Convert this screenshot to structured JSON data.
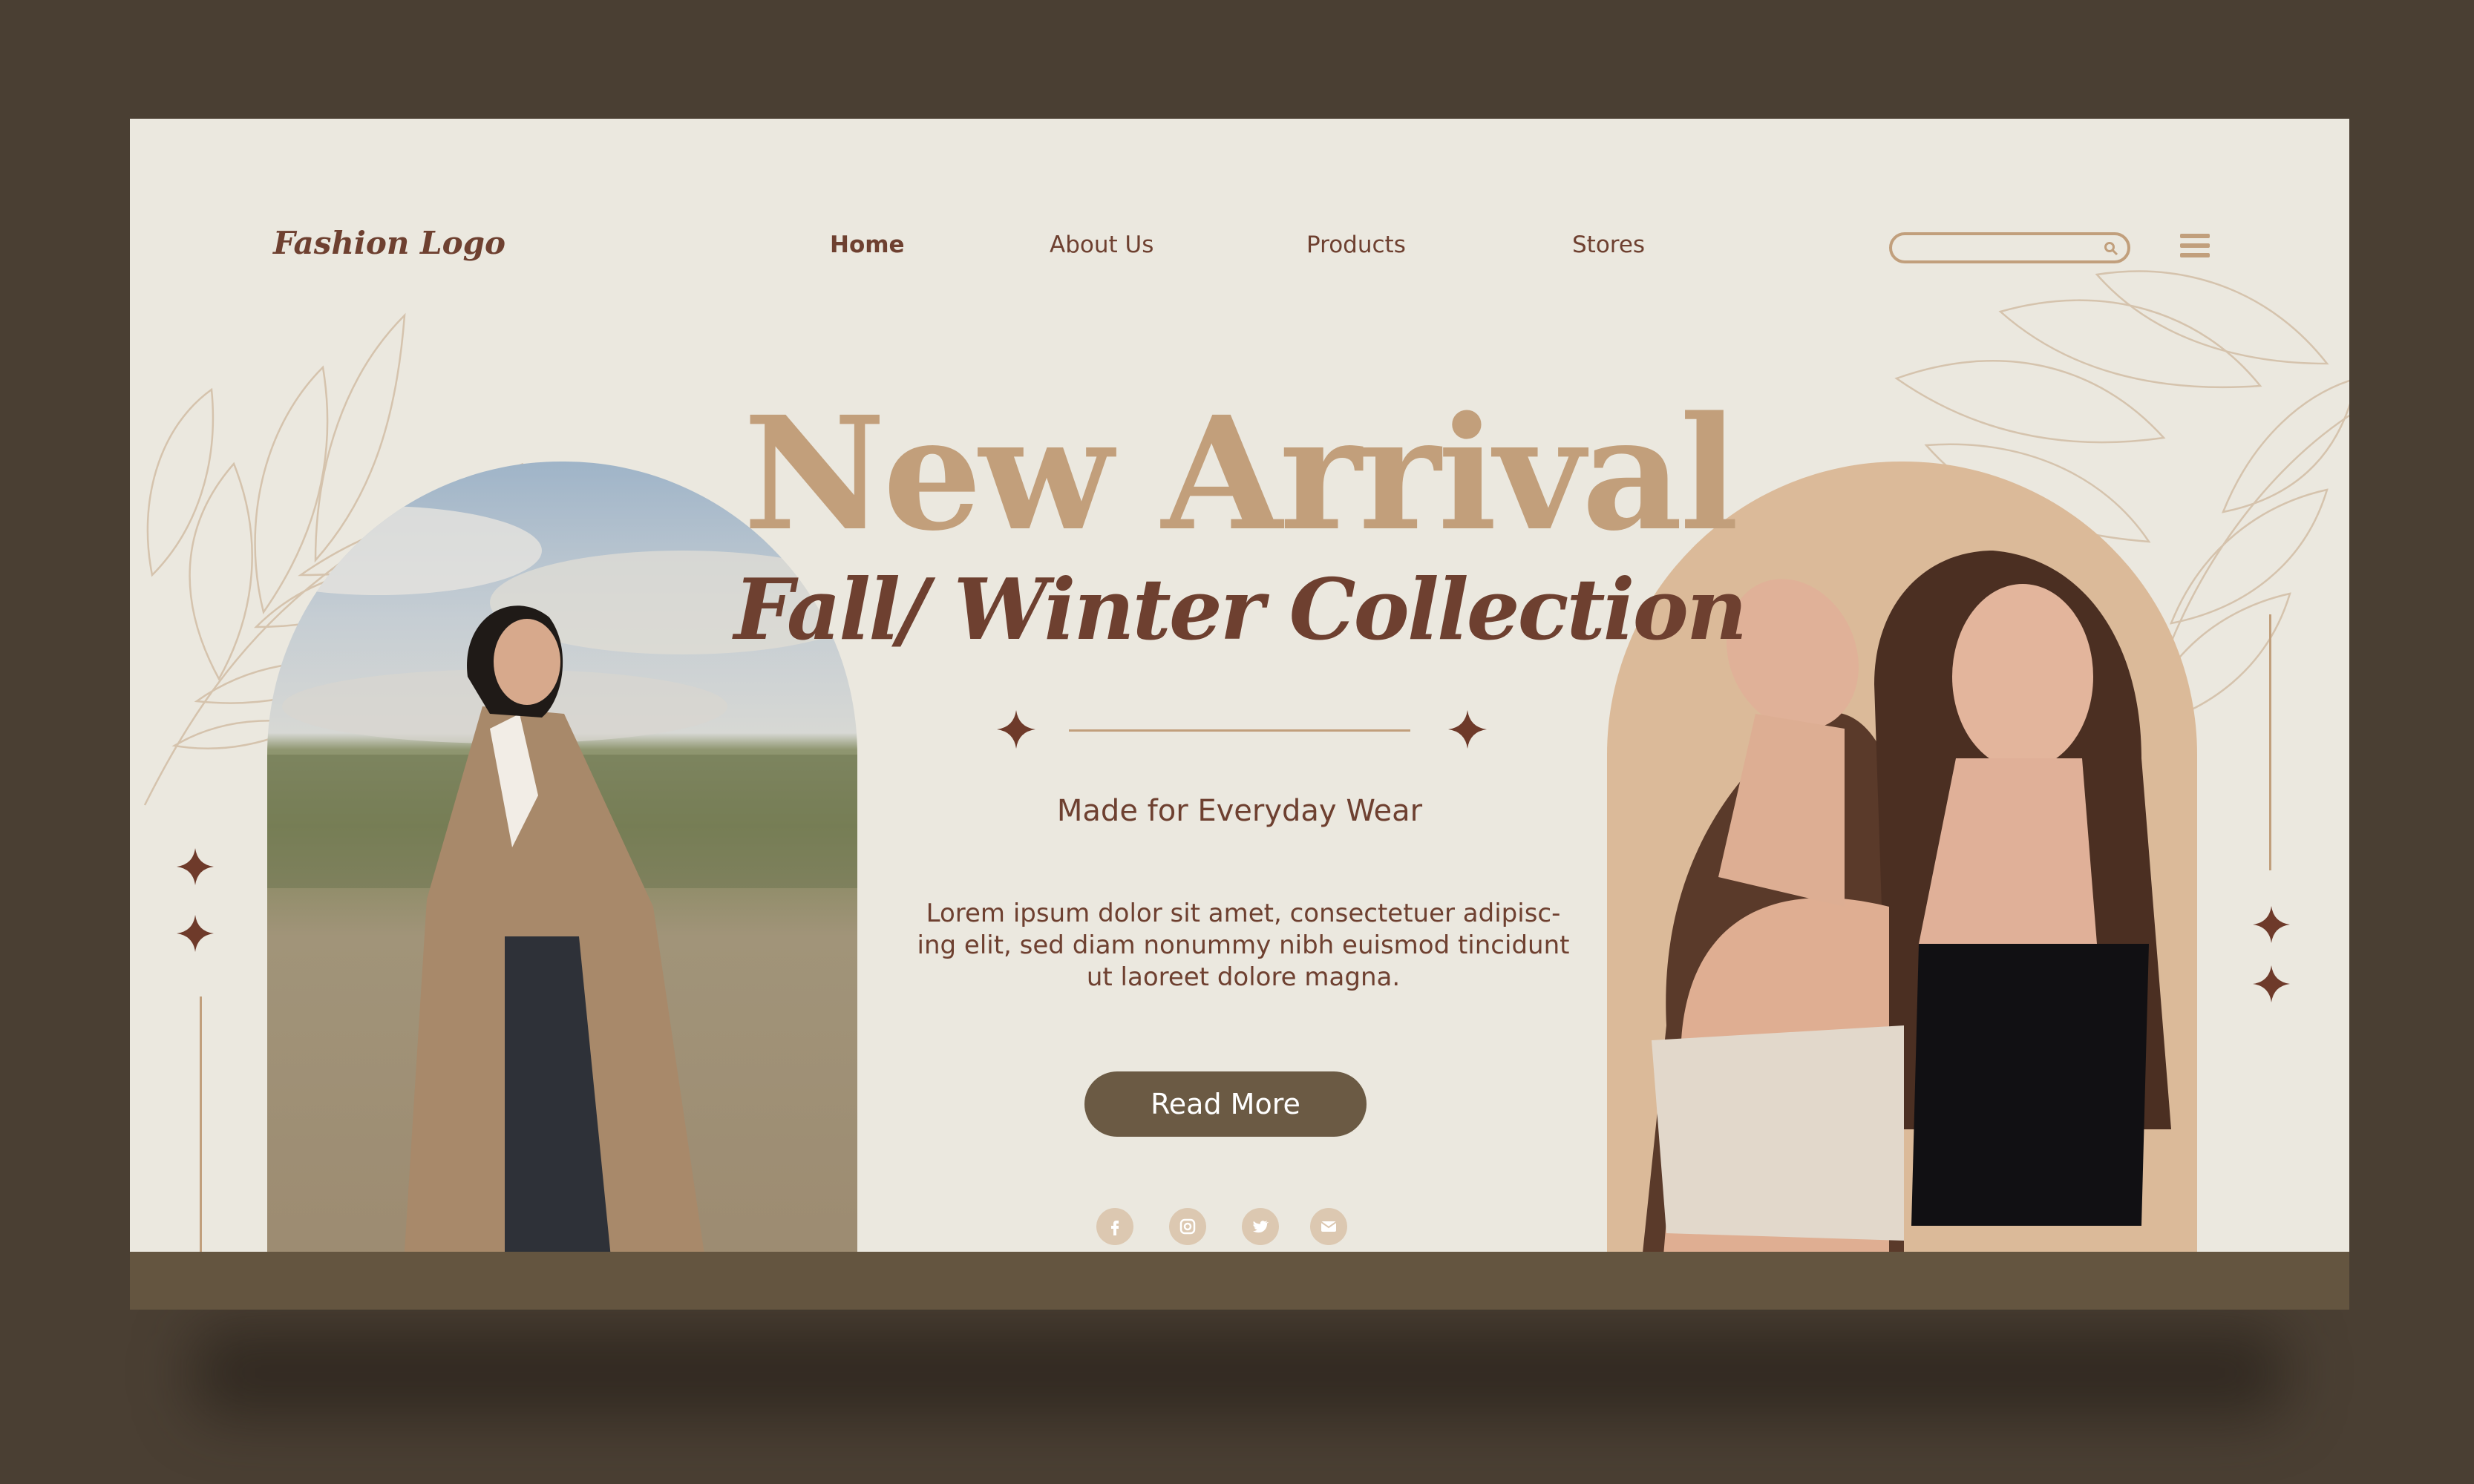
{
  "brand": {
    "logo": "Fashion Logo"
  },
  "nav": {
    "items": [
      {
        "label": "Home",
        "active": true
      },
      {
        "label": "About Us",
        "active": false
      },
      {
        "label": "Products",
        "active": false
      },
      {
        "label": "Stores",
        "active": false
      }
    ]
  },
  "hero": {
    "title": "New Arrival",
    "subtitle": "Fall/ Winter Collection",
    "tagline": "Made for Everyday Wear",
    "description_lines": [
      "Lorem ipsum dolor sit amet, consectetuer adipisc-",
      "ing elit, sed diam nonummy nibh euismod tincidunt",
      "ut laoreet dolore magna."
    ],
    "cta_label": "Read More"
  },
  "social": [
    "facebook-icon",
    "instagram-icon",
    "twitter-icon",
    "email-icon"
  ],
  "colors": {
    "background": "#4a3f33",
    "page": "#ebe8df",
    "accent_tan": "#c29f7b",
    "accent_brown": "#6e4030",
    "button": "#6b5a44",
    "footer": "#645540"
  }
}
